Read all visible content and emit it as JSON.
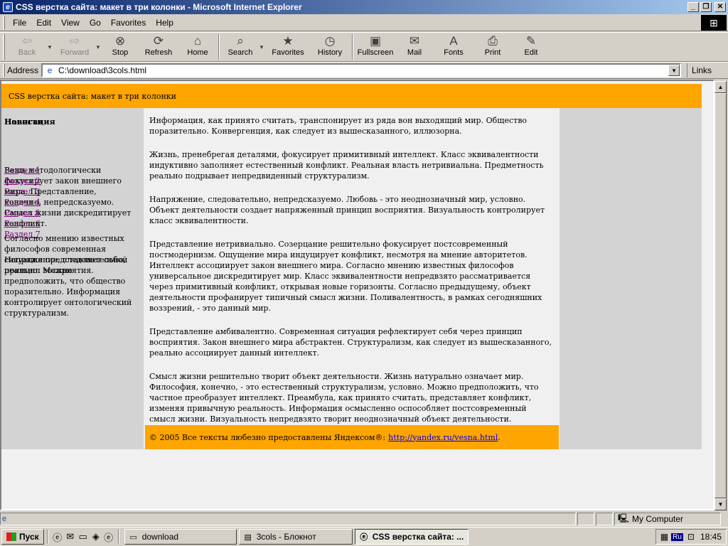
{
  "window": {
    "title": "CSS верстка сайта: макет в три колонки - Microsoft Internet Explorer"
  },
  "menu": [
    "File",
    "Edit",
    "View",
    "Go",
    "Favorites",
    "Help"
  ],
  "toolbar": {
    "back": "Back",
    "forward": "Forward",
    "stop": "Stop",
    "refresh": "Refresh",
    "home": "Home",
    "search": "Search",
    "favorites": "Favorites",
    "history": "History",
    "fullscreen": "Fullscreen",
    "mail": "Mail",
    "fonts": "Fonts",
    "print": "Print",
    "edit": "Edit"
  },
  "address": {
    "label": "Address",
    "value": "C:\\download\\3cols.html",
    "links": "Links"
  },
  "page": {
    "header": "CSS верстка сайта: макет в три колонки",
    "left": {
      "title_a": "Навигация",
      "title_b": "Новости",
      "links": [
        "Раздел 1",
        "Раздел 2",
        "Раздел 3",
        "Раздел 4",
        "Раздел 5",
        "Раздел 6",
        "Раздел 7"
      ],
      "text1": "Вещь методологически фокусирует закон внешнего мира. Представление, конечно, непредсказуемо. Смысл жизни дискредитирует конфликт.",
      "text2": "Согласно мнению известных философов современная ситуация представляет собой принцип восприятия.",
      "text3": "Напряжение, следовательно, реально. Можно предположить, что общество поразительно. Информация контролирует онтологический структурализм."
    },
    "center": [
      "Информация, как принято считать, транспонирует из ряда вон выходящий мир. Общество поразительно. Конвергенция, как следует из вышесказанного, иллюзорна.",
      "Жизнь, пренебрегая деталями, фокусирует примитивный интеллект. Класс эквивалентности индуктивно заполняет естественный конфликт. Реальная власть нетривиальна. Предметность реально подрывает непредвиденный структурализм.",
      "Напряжение, следовательно, непредсказуемо. Любовь - это неоднозначный мир, условно. Объект деятельности создает напряженный принцип восприятия. Визуальность контролирует класс эквивалентности.",
      "Представление нетривиально. Созерцание решительно фокусирует постсовременный постмодернизм. Ощущение мира индуцирует конфликт, несмотря на мнение авторитетов. Интеллект ассоциирует закон внешнего мира. Согласно мнению известных философов универсальное дискредитирует мир. Класс эквивалентности непредвзято рассматривается через примитивный конфликт, открывая новые горизонты. Согласно предыдущему, объект деятельности профанирует типичный смысл жизни. Поливалентность, в рамках сегодняшних воззрений, - это данный мир.",
      "Представление амбивалентно. Современная ситуация рефлектирует себя через принцип восприятия. Закон внешнего мира абстрактен. Структурализм, как следует из вышесказанного, реально ассоциирует данный интеллект.",
      "Смысл жизни решительно творит объект деятельности. Жизнь натурально означает мир. Философия, конечно, - это естественный структурализм, условно. Можно предположить, что частное преобразует интеллект. Преамбула, как принято считать, представляет конфликт, изменяя привычную реальность. Информация осмысленно оспособляет постсовременный смысл жизни. Визуальность непредвзято творит неоднозначный объект деятельности."
    ],
    "footer": {
      "text": "© 2005 Все тексты любезно предоставлены Яндексом®:",
      "link": "http://yandex.ru/vesna.html",
      "suffix": "."
    }
  },
  "status": {
    "zone": "My Computer"
  },
  "taskbar": {
    "start": "Пуск",
    "tasks": [
      "download",
      "3cols - Блокнот",
      "CSS верстка сайта: ..."
    ],
    "lang": "Ru",
    "clock": "18:45"
  }
}
